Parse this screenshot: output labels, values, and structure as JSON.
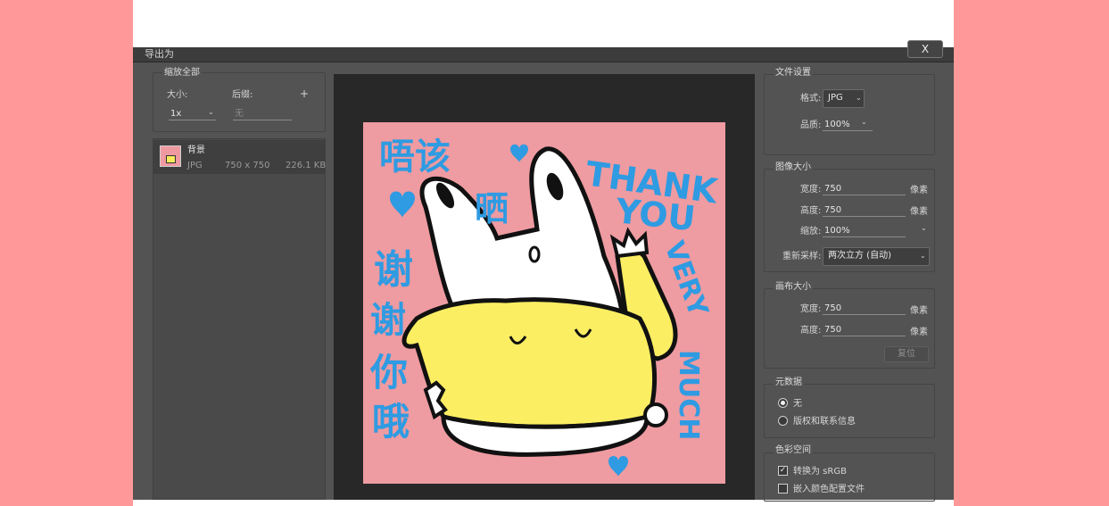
{
  "window": {
    "title": "导出为",
    "close_label": "X"
  },
  "scale_all": {
    "section_title": "缩放全部",
    "size_label": "大小:",
    "size_value": "1x",
    "suffix_label": "后缀:",
    "suffix_placeholder": "无",
    "add_label": "+"
  },
  "layers": [
    {
      "name": "背景",
      "format": "JPG",
      "dimensions": "750 x 750",
      "filesize": "226.1 KB"
    }
  ],
  "file_settings": {
    "section_title": "文件设置",
    "format_label": "格式:",
    "format_value": "JPG",
    "quality_label": "品质:",
    "quality_value": "100%"
  },
  "image_size": {
    "section_title": "图像大小",
    "width_label": "宽度:",
    "width_value": "750",
    "height_label": "高度:",
    "height_value": "750",
    "scale_label": "缩放:",
    "scale_value": "100%",
    "unit": "像素",
    "resample_label": "重新采样:",
    "resample_value": "两次立方 (自动)"
  },
  "canvas_size": {
    "section_title": "画布大小",
    "width_label": "宽度:",
    "width_value": "750",
    "height_label": "高度:",
    "height_value": "750",
    "unit": "像素",
    "reset_label": "复位"
  },
  "metadata": {
    "section_title": "元数据",
    "options": [
      {
        "label": "无",
        "selected": true
      },
      {
        "label": "版权和联系信息",
        "selected": false
      }
    ]
  },
  "color_space": {
    "section_title": "色彩空间",
    "options": [
      {
        "label": "转换为 sRGB",
        "checked": true
      },
      {
        "label": "嵌入颜色配置文件",
        "checked": false
      }
    ]
  },
  "preview_art": {
    "texts": [
      "唔该",
      "晒",
      "THANK",
      "YOU",
      "VERY",
      "MUCH",
      "谢",
      "谢",
      "你",
      "哦"
    ]
  },
  "colors": {
    "page_background": "#ff9999",
    "dialog_background": "#535353",
    "canvas_background": "#282828",
    "artwork_background": "#ee9ba1",
    "artwork_text": "#2e9be2",
    "shirt": "#fbee63"
  }
}
